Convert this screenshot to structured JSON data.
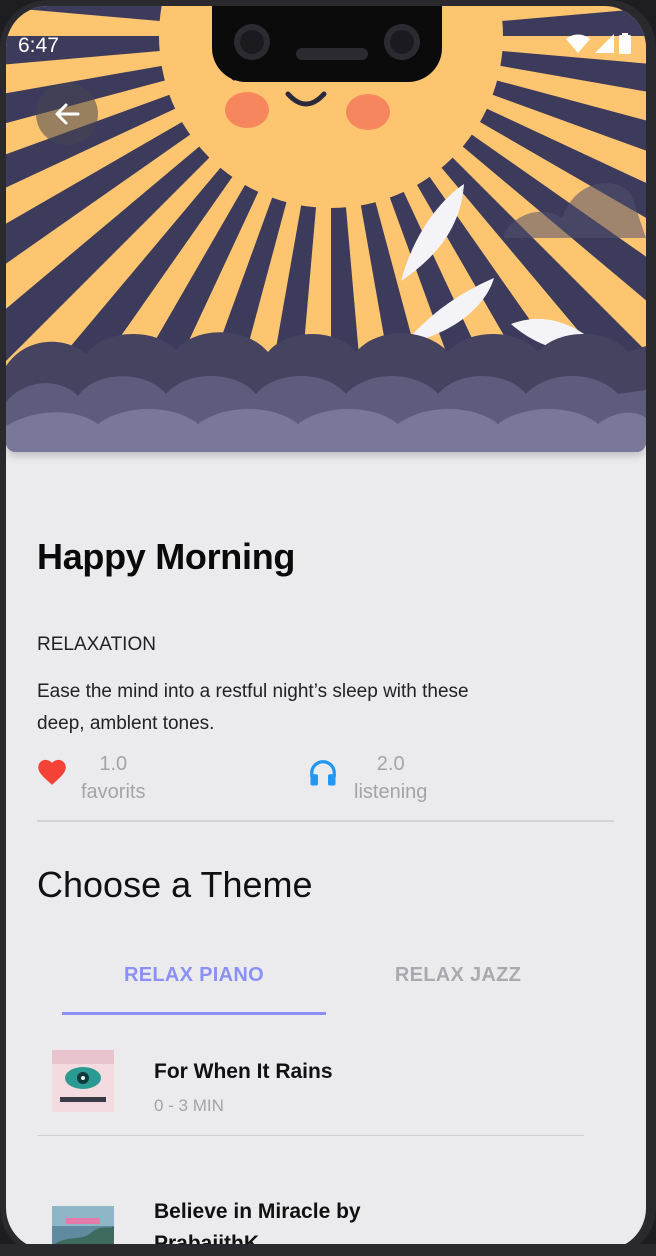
{
  "status_bar": {
    "time": "6:47"
  },
  "header": {
    "back_icon": "arrow-left-icon"
  },
  "hero": {
    "image": "smiling-sun-with-feathers-and-clouds-illustration"
  },
  "track_detail": {
    "title": "Happy Morning",
    "category": "RELAXATION",
    "description": "Ease the mind into a restful night’s sleep with these deep, amblent tones.",
    "favorites": {
      "value": "1.0",
      "label": "favorits",
      "icon": "heart-icon",
      "color": "#f44336"
    },
    "listening": {
      "value": "2.0",
      "label": "listening",
      "icon": "headphones-icon",
      "color": "#2196f3"
    }
  },
  "themes": {
    "heading": "Choose a Theme",
    "tabs": [
      {
        "label": "RELAX PIANO",
        "active": true
      },
      {
        "label": "RELAX JAZZ",
        "active": false
      }
    ],
    "accent_color": "#8a90f6",
    "tracks": [
      {
        "title": "For When It Rains",
        "subtitle": "0 - 3 MIN"
      },
      {
        "title": "Believe in Miracle by PrabajithK",
        "subtitle": ""
      }
    ]
  }
}
